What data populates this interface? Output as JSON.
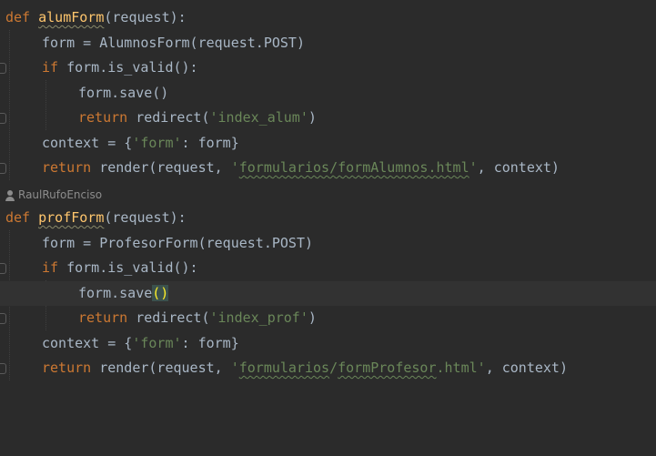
{
  "editor": {
    "author_annotation": "RaulRufoEnciso",
    "block1": {
      "def_kw": "def",
      "func_name": "alumForm",
      "signature": "(request):",
      "line2": "form = AlumnosForm(request.POST)",
      "if_kw": "if",
      "if_rest": " form.is_valid():",
      "save_call": "form.save()",
      "return_kw": "return",
      "redirect_pre": " redirect(",
      "redirect_str": "'index_alum'",
      "redirect_post": ")",
      "context_pre": "context = {",
      "context_str": "'form'",
      "context_post": ": form}",
      "render_pre": " render(request, ",
      "render_q1": "'",
      "render_path": "formularios/formAlumnos.html",
      "render_q2": "'",
      "render_post": ", context)"
    },
    "block2": {
      "def_kw": "def",
      "func_name": "profForm",
      "signature": "(request):",
      "line2": "form = ProfesorForm(request.POST)",
      "if_kw": "if",
      "if_rest": " form.is_valid():",
      "save_pre": "form.save",
      "save_parens": "()",
      "return_kw": "return",
      "redirect_pre": " redirect(",
      "redirect_str": "'index_prof'",
      "redirect_post": ")",
      "context_pre": "context = {",
      "context_str": "'form'",
      "context_post": ": form}",
      "render_pre": " render(request, ",
      "render_q1": "'",
      "render_path1": "formularios",
      "render_slash": "/",
      "render_path2": "formProfesor",
      "render_ext": ".html",
      "render_q2": "'",
      "render_post": ", context)"
    }
  },
  "colors": {
    "background": "#2b2b2b",
    "keyword": "#cc7832",
    "function": "#ffc66d",
    "string": "#6a8759",
    "text": "#a9b7c6"
  }
}
